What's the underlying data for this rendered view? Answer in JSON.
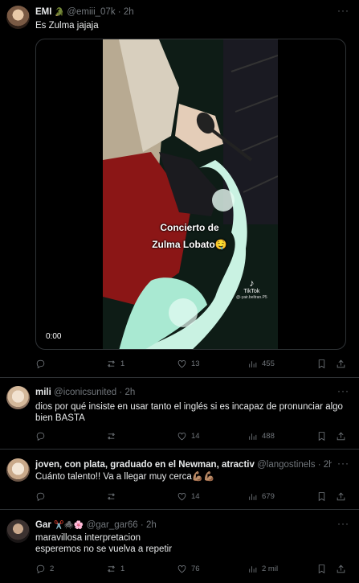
{
  "tweets": [
    {
      "name": "EMI",
      "name_emoji": "🐊",
      "handle": "@emiii_07k",
      "time": "2h",
      "text": "Es Zulma jajaja",
      "video": {
        "caption_line1": "Concierto de",
        "caption_line2": "Zulma Lobato🤤",
        "timestamp": "0:00",
        "brand": "TikTok",
        "brand_user": "@-yair.beltran.P5"
      },
      "replies": "",
      "retweets": "1",
      "likes": "13",
      "views": "455"
    },
    {
      "name": "mili",
      "handle": "@iconicsunited",
      "time": "2h",
      "text": "dios por qué insiste en usar tanto el inglés si es incapaz de pronunciar algo bien BASTA",
      "replies": "",
      "retweets": "",
      "likes": "14",
      "views": "488"
    },
    {
      "name": "joven, con plata, graduado en el Newman, atractiv",
      "handle": "@langostinels",
      "time": "2h",
      "text": "Cuánto talento!! Va a llegar muy cerca💪🏽💪🏽",
      "replies": "",
      "retweets": "",
      "likes": "14",
      "views": "679"
    },
    {
      "name": "Gar",
      "name_emoji": "✂️🕷️🌸",
      "handle": "@gar_gar66",
      "time": "2h",
      "text_line1": "maravillosa interpretacion",
      "text_line2": "esperemos no se vuelva a repetir",
      "replies": "2",
      "retweets": "1",
      "likes": "76",
      "views": "2 mil"
    }
  ],
  "separator": "·",
  "more_icon": "···",
  "colors": {
    "background": "#000000",
    "text": "#e7e9ea",
    "muted": "#71767b",
    "border": "#2f3336"
  }
}
